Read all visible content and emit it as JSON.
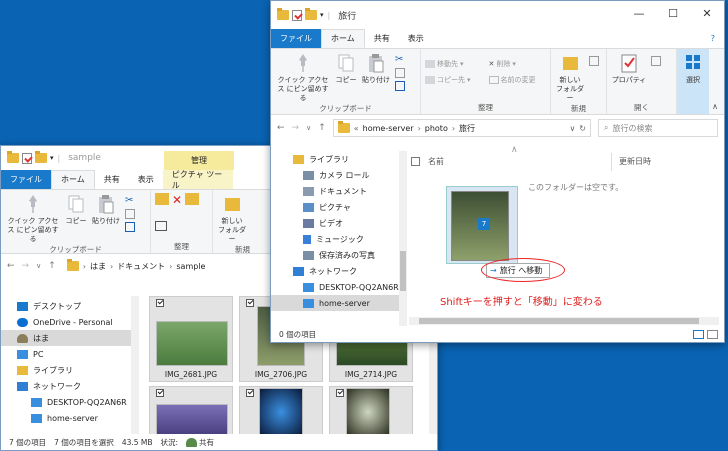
{
  "back": {
    "qat_label": "sample",
    "context_tab": "管理",
    "tabs": [
      "ファイル",
      "ホーム",
      "共有",
      "表示",
      "ピクチャ ツール"
    ],
    "ribbon": {
      "pin": "クイック アクセス にピン留めする",
      "copy": "コピー",
      "paste": "貼り付け",
      "clipboard": "クリップボード",
      "organize": "整理",
      "new_folder": "新しい フォルダー",
      "new": "新規"
    },
    "address": [
      "はま",
      "ドキュメント",
      "sample"
    ],
    "nav": [
      "デスクトップ",
      "OneDrive - Personal",
      "はま",
      "PC",
      "ライブラリ",
      "ネットワーク",
      "DESKTOP-QQ2AN6R",
      "home-server"
    ],
    "photos": [
      "IMG_2681.JPG",
      "IMG_2706.JPG",
      "IMG_2714.JPG"
    ],
    "status": {
      "count": "7 個の項目",
      "selected": "7 個の項目を選択",
      "size": "43.5 MB",
      "state": "状況:",
      "share": "共有"
    }
  },
  "front": {
    "title": "旅行",
    "tabs": [
      "ファイル",
      "ホーム",
      "共有",
      "表示"
    ],
    "ribbon": {
      "pin": "クイック アクセス にピン留めする",
      "copy": "コピー",
      "paste": "貼り付け",
      "clipboard": "クリップボード",
      "move_to": "移動先",
      "copy_to": "コピー先",
      "delete": "削除",
      "rename": "名前の変更",
      "organize": "整理",
      "new_folder": "新しい フォルダー",
      "new": "新規",
      "properties": "プロパティ",
      "open": "開く",
      "select": "選択"
    },
    "address": [
      "home-server",
      "photo",
      "旅行"
    ],
    "search_placeholder": "旅行の検索",
    "nav": [
      "ライブラリ",
      "カメラ ロール",
      "ドキュメント",
      "ピクチャ",
      "ビデオ",
      "ミュージック",
      "保存済みの写真",
      "ネットワーク",
      "DESKTOP-QQ2AN6R",
      "home-server"
    ],
    "col_name": "名前",
    "col_date": "更新日時",
    "empty": "このフォルダーは空です。",
    "drag_count": "7",
    "drag_tip": "旅行 へ移動",
    "status": "0 個の項目"
  },
  "annotation": "Shiftキーを押すと「移動」に変わる"
}
